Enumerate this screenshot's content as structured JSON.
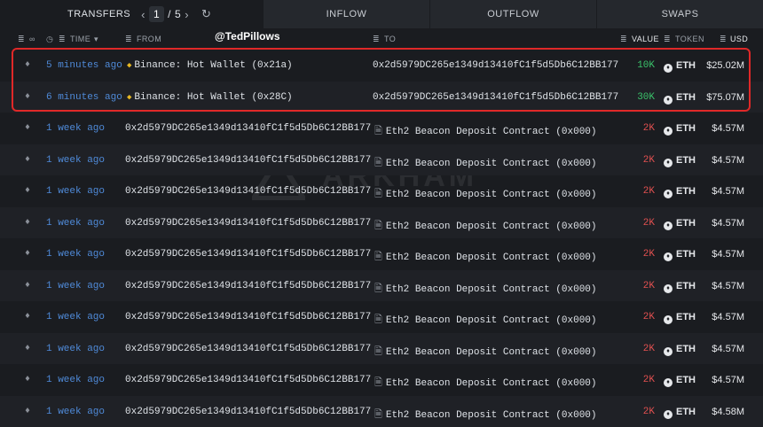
{
  "tabs": {
    "transfers": "TRANSFERS",
    "page_current": "1",
    "page_sep": "/",
    "page_total": "5",
    "inflow": "INFLOW",
    "outflow": "OUTFLOW",
    "swaps": "SWAPS"
  },
  "header": {
    "time": "TIME",
    "from": "FROM",
    "to": "TO",
    "value": "VALUE",
    "token": "TOKEN",
    "usd": "USD"
  },
  "watermark_user": "@TedPillows",
  "watermark_brand": "ARKHAM",
  "colors": {
    "highlight": "#e02828",
    "time_link": "#4f8ad8",
    "value_in": "#3ac26a",
    "value_out": "#e05050"
  },
  "rows": [
    {
      "time": "5 minutes ago",
      "from": "Binance: Hot Wallet (0x21a)",
      "to": "0x2d5979DC265e1349d13410fC1f5d5Db6C12BB177",
      "value": "10K",
      "value_color": "green",
      "token": "ETH",
      "usd": "$25.02M",
      "from_icon": "binance-icon",
      "to_icon": ""
    },
    {
      "time": "6 minutes ago",
      "from": "Binance: Hot Wallet (0x28C)",
      "to": "0x2d5979DC265e1349d13410fC1f5d5Db6C12BB177",
      "value": "30K",
      "value_color": "green",
      "token": "ETH",
      "usd": "$75.07M",
      "from_icon": "binance-icon",
      "to_icon": ""
    },
    {
      "time": "1 week ago",
      "from": "0x2d5979DC265e1349d13410fC1f5d5Db6C12BB177",
      "to": "Eth2 Beacon Deposit Contract (0x000)",
      "value": "2K",
      "value_color": "red",
      "token": "ETH",
      "usd": "$4.57M",
      "from_icon": "",
      "to_icon": "document-icon"
    },
    {
      "time": "1 week ago",
      "from": "0x2d5979DC265e1349d13410fC1f5d5Db6C12BB177",
      "to": "Eth2 Beacon Deposit Contract (0x000)",
      "value": "2K",
      "value_color": "red",
      "token": "ETH",
      "usd": "$4.57M",
      "from_icon": "",
      "to_icon": "document-icon"
    },
    {
      "time": "1 week ago",
      "from": "0x2d5979DC265e1349d13410fC1f5d5Db6C12BB177",
      "to": "Eth2 Beacon Deposit Contract (0x000)",
      "value": "2K",
      "value_color": "red",
      "token": "ETH",
      "usd": "$4.57M",
      "from_icon": "",
      "to_icon": "document-icon"
    },
    {
      "time": "1 week ago",
      "from": "0x2d5979DC265e1349d13410fC1f5d5Db6C12BB177",
      "to": "Eth2 Beacon Deposit Contract (0x000)",
      "value": "2K",
      "value_color": "red",
      "token": "ETH",
      "usd": "$4.57M",
      "from_icon": "",
      "to_icon": "document-icon"
    },
    {
      "time": "1 week ago",
      "from": "0x2d5979DC265e1349d13410fC1f5d5Db6C12BB177",
      "to": "Eth2 Beacon Deposit Contract (0x000)",
      "value": "2K",
      "value_color": "red",
      "token": "ETH",
      "usd": "$4.57M",
      "from_icon": "",
      "to_icon": "document-icon"
    },
    {
      "time": "1 week ago",
      "from": "0x2d5979DC265e1349d13410fC1f5d5Db6C12BB177",
      "to": "Eth2 Beacon Deposit Contract (0x000)",
      "value": "2K",
      "value_color": "red",
      "token": "ETH",
      "usd": "$4.57M",
      "from_icon": "",
      "to_icon": "document-icon"
    },
    {
      "time": "1 week ago",
      "from": "0x2d5979DC265e1349d13410fC1f5d5Db6C12BB177",
      "to": "Eth2 Beacon Deposit Contract (0x000)",
      "value": "2K",
      "value_color": "red",
      "token": "ETH",
      "usd": "$4.57M",
      "from_icon": "",
      "to_icon": "document-icon"
    },
    {
      "time": "1 week ago",
      "from": "0x2d5979DC265e1349d13410fC1f5d5Db6C12BB177",
      "to": "Eth2 Beacon Deposit Contract (0x000)",
      "value": "2K",
      "value_color": "red",
      "token": "ETH",
      "usd": "$4.57M",
      "from_icon": "",
      "to_icon": "document-icon"
    },
    {
      "time": "1 week ago",
      "from": "0x2d5979DC265e1349d13410fC1f5d5Db6C12BB177",
      "to": "Eth2 Beacon Deposit Contract (0x000)",
      "value": "2K",
      "value_color": "red",
      "token": "ETH",
      "usd": "$4.57M",
      "from_icon": "",
      "to_icon": "document-icon"
    },
    {
      "time": "1 week ago",
      "from": "0x2d5979DC265e1349d13410fC1f5d5Db6C12BB177",
      "to": "Eth2 Beacon Deposit Contract (0x000)",
      "value": "2K",
      "value_color": "red",
      "token": "ETH",
      "usd": "$4.58M",
      "from_icon": "",
      "to_icon": "document-icon"
    }
  ]
}
